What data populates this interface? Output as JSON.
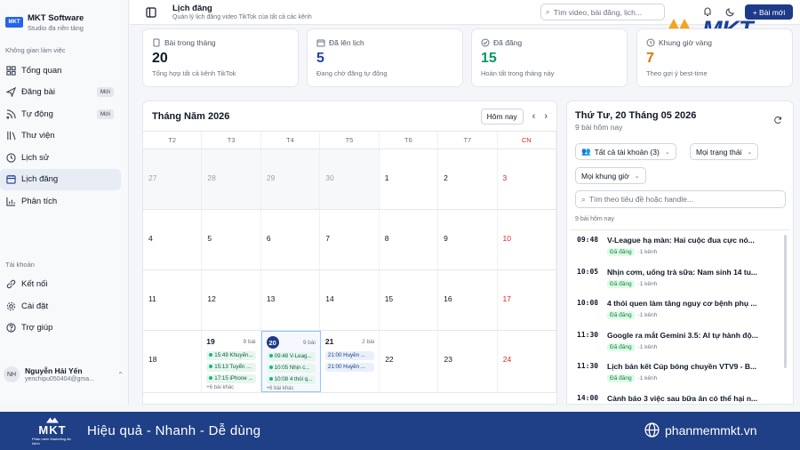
{
  "brand": {
    "logo": "MKT",
    "name": "MKT Software",
    "subtitle": "Studio đa nền tảng"
  },
  "sidebar": {
    "section_workspace": "Không gian làm việc",
    "items": [
      {
        "label": "Tổng quan",
        "icon": "grid-icon"
      },
      {
        "label": "Đăng bài",
        "icon": "send-icon",
        "badge": "Mới"
      },
      {
        "label": "Tự động",
        "icon": "rss-icon",
        "badge": "Mới"
      },
      {
        "label": "Thư viện",
        "icon": "library-icon"
      },
      {
        "label": "Lịch sử",
        "icon": "history-icon"
      },
      {
        "label": "Lịch đăng",
        "icon": "calendar-icon",
        "active": true
      },
      {
        "label": "Phân tích",
        "icon": "chart-icon"
      }
    ],
    "section_account": "Tài khoản",
    "account_items": [
      {
        "label": "Kết nối",
        "icon": "link-icon"
      },
      {
        "label": "Cài đặt",
        "icon": "settings-icon"
      },
      {
        "label": "Trợ giúp",
        "icon": "help-icon"
      }
    ],
    "user": {
      "initials": "NH",
      "name": "Nguyễn Hải Yến",
      "email": "yenchipu050404@gma..."
    }
  },
  "topbar": {
    "title": "Lịch đăng",
    "subtitle": "Quản lý lịch đăng video TikTok của tất cả các kênh",
    "search_placeholder": "Tìm video, bài đăng, lịch...",
    "new_button": "+ Bài mới"
  },
  "stats": [
    {
      "label": "Bài trong tháng",
      "value": "20",
      "sub": "Tổng hợp tất cả kênh TikTok",
      "color": "#111827",
      "icon": "file-icon"
    },
    {
      "label": "Đã lên lịch",
      "value": "5",
      "sub": "Đang chờ đăng tự động",
      "color": "#1e40af",
      "icon": "calendar-icon"
    },
    {
      "label": "Đã đăng",
      "value": "15",
      "sub": "Hoàn tất trong tháng này",
      "color": "#059669",
      "icon": "check-circle-icon"
    },
    {
      "label": "Khung giờ vàng",
      "value": "7",
      "sub": "Theo gợi ý best-time",
      "color": "#d97706",
      "icon": "clock-icon"
    }
  ],
  "calendar": {
    "title": "Tháng Năm 2026",
    "today_button": "Hôm nay",
    "prev": "‹",
    "next": "›",
    "weekdays": [
      "T2",
      "T3",
      "T4",
      "T5",
      "T6",
      "T7",
      "CN"
    ],
    "weeks": [
      [
        "27",
        "28",
        "29",
        "30",
        "1",
        "2",
        "3"
      ],
      [
        "4",
        "5",
        "6",
        "7",
        "8",
        "9",
        "10"
      ],
      [
        "11",
        "12",
        "13",
        "14",
        "15",
        "16",
        "17"
      ]
    ],
    "day19": {
      "num": "19",
      "count": "9 bài",
      "events": [
        "15:49 Khuyến...",
        "15:13 Tuyển ...",
        "17:15 iPhone ..."
      ],
      "more": "+6 bài khác"
    },
    "day20": {
      "num": "20",
      "count": "9 bài",
      "events": [
        "09:48 V-Leag...",
        "10:05 Nhịn c...",
        "10:08 4 thói q..."
      ],
      "more": "+6 bài khác"
    },
    "day21": {
      "num": "21",
      "count": "2 bài",
      "events": [
        "21:00 Huyền ...",
        "21:00 Huyền ..."
      ]
    },
    "last_week": [
      "18",
      "22",
      "23",
      "24"
    ]
  },
  "panel": {
    "title": "Thứ Tư, 20 Tháng 05 2026",
    "subtitle": "9 bài hôm nay",
    "filter_accounts": "Tất cả tài khoản (3)",
    "filter_status": "Mọi trạng thái",
    "filter_time": "Mọi khung giờ",
    "search_placeholder": "Tìm theo tiêu đề hoặc handle...",
    "count": "9 bài hôm nay",
    "items": [
      {
        "time": "09:48",
        "title": "V-League hạ màn: Hai cuộc đua cực nó...",
        "status": "Đã đăng",
        "channels": "1 kênh"
      },
      {
        "time": "10:05",
        "title": "Nhịn cơm, uống trà sữa: Nam sinh 14 tu...",
        "status": "Đã đăng",
        "channels": "1 kênh"
      },
      {
        "time": "10:08",
        "title": "4 thói quen làm tăng nguy cơ bệnh phụ ...",
        "status": "Đã đăng",
        "channels": "1 kênh"
      },
      {
        "time": "11:30",
        "title": "Google ra mắt Gemini 3.5: AI tự hành độ...",
        "status": "Đã đăng",
        "channels": "1 kênh"
      },
      {
        "time": "11:30",
        "title": "Lịch bán kết Cúp bóng chuyền VTV9 - B...",
        "status": "Đã đăng",
        "channels": "1 kênh"
      },
      {
        "time": "14:00",
        "title": "Cảnh báo 3 việc sau bữa ăn có thể hại n...",
        "status": "",
        "channels": ""
      }
    ]
  },
  "footer": {
    "logo": "MKT",
    "logo_sub": "Phần mềm Marketing đa kênh",
    "tagline": "Hiệu quả - Nhanh - Dễ dùng",
    "website": "phanmemmkt.vn"
  },
  "watermark": {
    "text": "MKT"
  }
}
